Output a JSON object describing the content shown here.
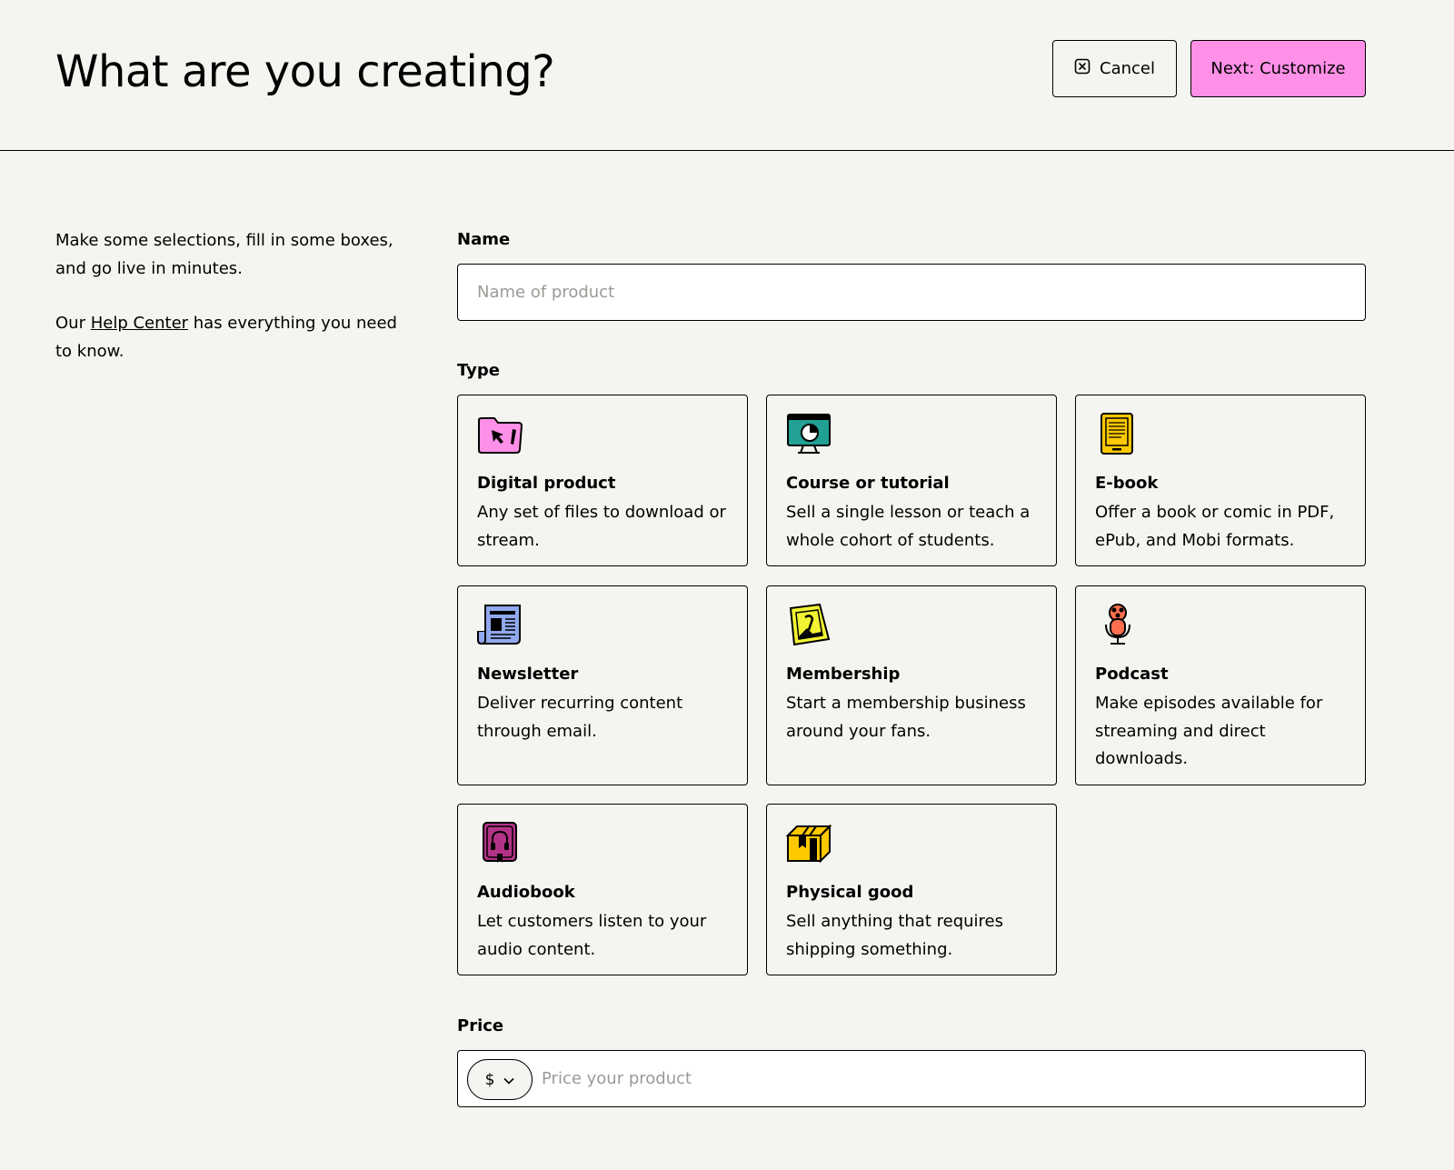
{
  "header": {
    "title": "What are you creating?",
    "cancel_label": "Cancel",
    "next_label": "Next: Customize"
  },
  "intro": {
    "line1": "Make some selections, fill in some boxes, and go live in minutes.",
    "help_prefix": "Our ",
    "help_link": "Help Center",
    "help_suffix": " has everything you need to know."
  },
  "name_field": {
    "label": "Name",
    "placeholder": "Name of product",
    "value": ""
  },
  "type_section": {
    "label": "Type",
    "cards": [
      {
        "title": "Digital product",
        "desc": "Any set of files to download or stream.",
        "icon": "folder-cursor-icon",
        "color": "#ff90e8"
      },
      {
        "title": "Course or tutorial",
        "desc": "Sell a single lesson or teach a whole cohort of students.",
        "icon": "presentation-board-icon",
        "color": "#23a094"
      },
      {
        "title": "E-book",
        "desc": "Offer a book or comic in PDF, ePub, and Mobi formats.",
        "icon": "ereader-icon",
        "color": "#ffc900"
      },
      {
        "title": "Newsletter",
        "desc": "Deliver recurring content through email.",
        "icon": "newspaper-icon",
        "color": "#90a8ed"
      },
      {
        "title": "Membership",
        "desc": "Start a membership business around your fans.",
        "icon": "membership-card-icon",
        "color": "#f1f333"
      },
      {
        "title": "Podcast",
        "desc": "Make episodes available for streaming and direct downloads.",
        "icon": "microphone-icon",
        "color": "#ff7051"
      },
      {
        "title": "Audiobook",
        "desc": "Let customers listen to your audio content.",
        "icon": "headphones-book-icon",
        "color": "#b23386"
      },
      {
        "title": "Physical good",
        "desc": "Sell anything that requires shipping something.",
        "icon": "package-box-icon",
        "color": "#ffc900"
      }
    ]
  },
  "price_field": {
    "label": "Price",
    "currency": "$",
    "placeholder": "Price your product",
    "value": ""
  },
  "colors": {
    "background": "#f4f4f0",
    "accent": "#ff90e8",
    "border": "#000000"
  }
}
